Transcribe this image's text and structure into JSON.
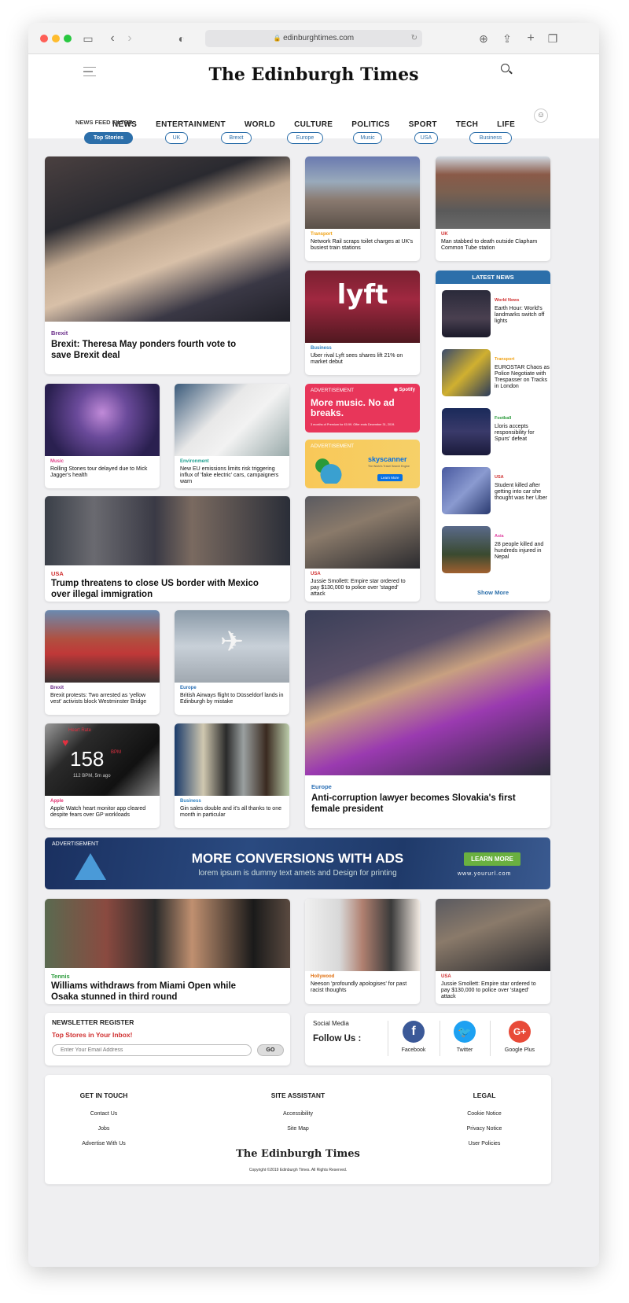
{
  "browser": {
    "url": "edinburghtimes.com"
  },
  "site": {
    "logo": "The Edinburgh Times",
    "nav": [
      "NEWS",
      "ENTERTAINMENT",
      "WORLD",
      "CULTURE",
      "POLITICS",
      "SPORT",
      "TECH",
      "LIFE"
    ],
    "filter_label": "NEWS FEED FILTER",
    "filters": [
      "Top Stories",
      "UK",
      "Brexit",
      "Europe",
      "Music",
      "USA",
      "Business"
    ]
  },
  "articles": {
    "a1": {
      "cat": "Brexit",
      "title": "Brexit: Theresa May ponders fourth vote to save Brexit deal"
    },
    "a2": {
      "cat": "Transport",
      "title": "Network Rail scraps toilet charges at UK's busiest train stations"
    },
    "a3": {
      "cat": "UK",
      "title": "Man stabbed to death outside Clapham Common Tube station"
    },
    "a4": {
      "cat": "Business",
      "title": "Uber rival Lyft sees shares lift 21% on market debut"
    },
    "a5": {
      "cat": "Music",
      "title": "Rolling Stones tour delayed due to Mick Jagger's health"
    },
    "a6": {
      "cat": "Environment",
      "title": "New EU emissions limits risk triggering influx of 'fake electric' cars, campaigners warn"
    },
    "a7": {
      "cat": "USA",
      "title": "Trump threatens to close US border with Mexico over illegal immigration"
    },
    "a8": {
      "cat": "USA",
      "title": "Jussie Smollett: Empire star ordered to pay $130,000 to police over 'staged' attack"
    },
    "a9": {
      "cat": "Brexit",
      "title": "Brexit protests: Two arrested as 'yellow vest' activists block Westminster Bridge"
    },
    "a10": {
      "cat": "Europe",
      "title": "British Airways flight to Düsseldorf lands in Edinburgh by mistake"
    },
    "a11": {
      "cat": "Europe",
      "title": "Anti-corruption lawyer becomes Slovakia's first female president"
    },
    "a12": {
      "cat": "Apple",
      "title": "Apple Watch heart monitor app cleared despite fears over GP workloads"
    },
    "a13": {
      "cat": "Business",
      "title": "Gin sales double and it's all thanks to one month in particular"
    },
    "a14": {
      "cat": "Tennis",
      "title": "Williams withdraws from Miami Open while Osaka stunned in third round"
    },
    "a15": {
      "cat": "Hollywood",
      "title": "Neeson 'profoundly apologises' for past racist thoughts"
    },
    "a16": {
      "cat": "USA",
      "title": "Jussie Smollett: Empire star ordered to pay $130,000 to police over 'staged' attack"
    }
  },
  "watch": {
    "heart": "Heart Rate",
    "bpm": "158",
    "sub": "112 BPM, 5m ago",
    "unit": "BPM"
  },
  "latest": {
    "header": "LATEST NEWS",
    "show_more": "Show More",
    "items": [
      {
        "cat": "World News",
        "title": "Earth Hour: World's landmarks switch off lights"
      },
      {
        "cat": "Transport",
        "title": "EUROSTAR Chaos as Police Negotiate with Trespasser on Tracks in London"
      },
      {
        "cat": "Football",
        "title": "Lloris accepts responsibility for Spurs' defeat"
      },
      {
        "cat": "USA",
        "title": "Student killed after getting into car she thought was her Uber"
      },
      {
        "cat": "Asia",
        "title": "28 people killed and hundreds injured in Nepal"
      }
    ]
  },
  "ads": {
    "label": "ADVERTISEMENT",
    "spotify": {
      "brand": "Spotify",
      "headline": "More music. No ad breaks.",
      "fine": "3 months of Premium for £0.99. Offer ends December 31, 2019."
    },
    "skyscanner": {
      "brand": "skyscanner",
      "tag": "The World's Travel Search Engine",
      "cta": "Learn More"
    },
    "banner": {
      "headline": "MORE CONVERSIONS WITH ADS",
      "sub": "lorem ipsum is dummy text amets and Design for printing",
      "cta": "LEARN MORE",
      "url": "www.yoururl.com"
    }
  },
  "newsletter": {
    "title": "NEWSLETTER REGISTER",
    "subtitle": "Top Stores in Your Inbox!",
    "placeholder": "Enter Your Email Address",
    "button": "GO"
  },
  "social": {
    "title": "Social Media",
    "follow": "Follow Us :",
    "facebook": "Facebook",
    "twitter": "Twitter",
    "google": "Google Plus"
  },
  "footer": {
    "cols": [
      {
        "title": "GET IN TOUCH",
        "links": [
          "Contact Us",
          "Jobs",
          "Advertise With Us"
        ]
      },
      {
        "title": "SITE ASSISTANT",
        "links": [
          "Accessibility",
          "Site Map"
        ]
      },
      {
        "title": "LEGAL",
        "links": [
          "Cookie Notice",
          "Privacy Notice",
          "User Policies"
        ]
      }
    ],
    "logo": "The Edinburgh Times",
    "copyright": "Copyright ©2019 Edinburgh Times. All Rights Reserved."
  },
  "colors": {
    "accent": "#2c6faa",
    "brexit": "#6b2f8a",
    "transport": "#f0a010",
    "uk": "#d03030",
    "business": "#2a7fc0",
    "music": "#e0408a",
    "environment": "#1fa090",
    "usa": "#d03030",
    "europe": "#2a6fb5",
    "apple": "#e03070",
    "tennis": "#2a9a3a",
    "hollywood": "#e07010",
    "worldnews": "#d03030",
    "football": "#2a9a3a",
    "asia": "#e040a0"
  }
}
